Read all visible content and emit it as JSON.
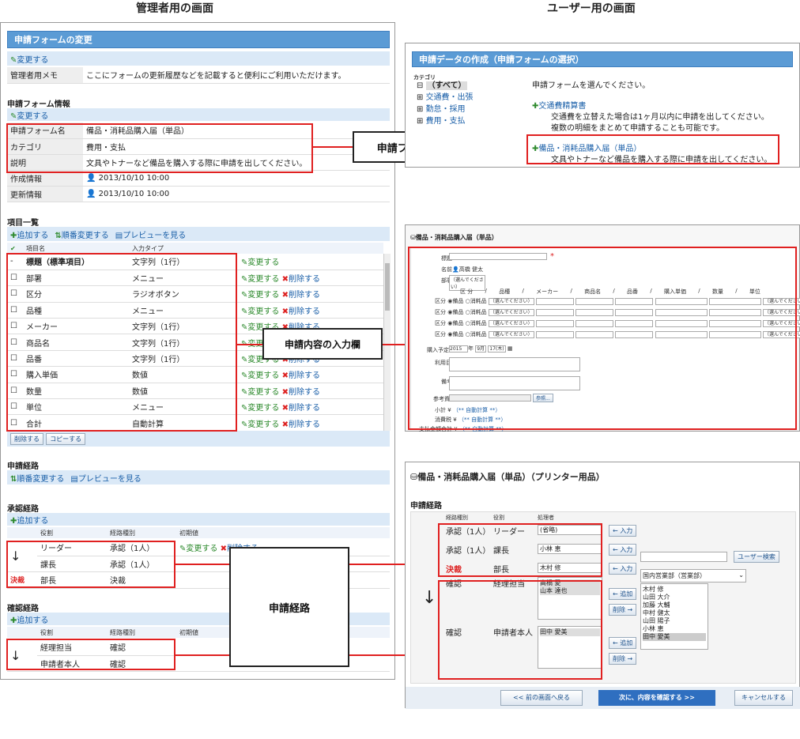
{
  "headings": {
    "admin": "管理者用の画面",
    "user": "ユーザー用の画面"
  },
  "admin": {
    "title": "申請フォームの変更",
    "change_link": "変更する",
    "memo_label": "管理者用メモ",
    "memo_value": "ここにフォームの更新履歴などを記載すると便利にご利用いただけます。",
    "info_section": "申請フォーム情報",
    "info": [
      {
        "k": "申請フォーム名",
        "v": "備品・消耗品購入届（単品）"
      },
      {
        "k": "カテゴリ",
        "v": "費用・支払"
      },
      {
        "k": "説明",
        "v": "文具やトナーなど備品を購入する際に申請を出してください。"
      },
      {
        "k": "作成情報",
        "v": "2013/10/10 10:00"
      },
      {
        "k": "更新情報",
        "v": "2013/10/10 10:00"
      }
    ],
    "items_section": "項目一覧",
    "items_links": [
      "追加する",
      "順番変更する",
      "プレビューを見る"
    ],
    "items_head": [
      "項目名",
      "入力タイプ"
    ],
    "items": [
      {
        "chk": "-",
        "name": "標題（標準項目）",
        "type": "文字列（1行）",
        "del": false
      },
      {
        "chk": "☐",
        "name": "部署",
        "type": "メニュー",
        "del": true
      },
      {
        "chk": "☐",
        "name": "区分",
        "type": "ラジオボタン",
        "del": true
      },
      {
        "chk": "☐",
        "name": "品種",
        "type": "メニュー",
        "del": true
      },
      {
        "chk": "☐",
        "name": "メーカー",
        "type": "文字列（1行）",
        "del": true
      },
      {
        "chk": "☐",
        "name": "商品名",
        "type": "文字列（1行）",
        "del": true
      },
      {
        "chk": "☐",
        "name": "品番",
        "type": "文字列（1行）",
        "del": true
      },
      {
        "chk": "☐",
        "name": "購入単価",
        "type": "数値",
        "del": true
      },
      {
        "chk": "☐",
        "name": "数量",
        "type": "数値",
        "del": true
      },
      {
        "chk": "☐",
        "name": "単位",
        "type": "メニュー",
        "del": true
      },
      {
        "chk": "☐",
        "name": "合計",
        "type": "自動計算",
        "del": true
      }
    ],
    "change_label": "変更する",
    "delete_label": "削除する",
    "bottom_btns": [
      "削除する",
      "コピーする"
    ],
    "route_section": "申請経路",
    "route_links": [
      "順番変更する",
      "プレビューを見る"
    ],
    "approval_section": "承認経路",
    "add_label": "追加する",
    "route_head": [
      "役割",
      "経路種別",
      "初期値"
    ],
    "approval": [
      {
        "role": "リーダー",
        "kind": "承認（1人）"
      },
      {
        "role": "課長",
        "kind": "承認（1人）"
      },
      {
        "role": "部長",
        "kind": "決裁",
        "mark": "決裁"
      }
    ],
    "confirm_section": "確認経路",
    "confirm": [
      {
        "role": "経理担当",
        "kind": "確認"
      },
      {
        "role": "申請者本人",
        "kind": "確認"
      }
    ]
  },
  "callouts": {
    "form_name": "申請フォーム名",
    "input": "申請内容の入力欄",
    "route": "申請経路"
  },
  "user1": {
    "title": "申請データの作成（申請フォームの選択）",
    "cat_label": "カテゴリ",
    "cats": [
      "（すべて）",
      "交通費・出張",
      "勤怠・採用",
      "費用・支払"
    ],
    "prompt": "申請フォームを選んでください。",
    "form1_name": "交通費精算書",
    "form1_desc1": "交通費を立替えた場合は1ヶ月以内に申請を出してください。",
    "form1_desc2": "複数の明細をまとめて申請することも可能です。",
    "form2_name": "備品・消耗品購入届（単品）",
    "form2_desc": "文具やトナーなど備品を購入する際に申請を出してください。"
  },
  "user2": {
    "title": "備品・消耗品購入届（単品）",
    "rows": {
      "subject": "標題",
      "name": "名前",
      "name_val": "高橋 健太",
      "dept": "部署",
      "select": "（選んでください）",
      "cols": [
        "区 分",
        "品種",
        "メーカー",
        "商品名",
        "品番",
        "購入単価",
        "数量",
        "単位"
      ],
      "kubun": "区分",
      "radio1": "備品",
      "radio2": "消耗品",
      "buydate": "購入予定日",
      "year": "2015",
      "y": "年",
      "month": "9月",
      "day": "17(木)",
      "usage": "利用目的",
      "note": "備考",
      "file": "参考資料",
      "ref_btn": "参照...",
      "subtotal": "小計",
      "tax": "消費税",
      "total": "支払金額合計",
      "yen": "¥",
      "auto": "（** 自動計算 **）"
    }
  },
  "user3": {
    "title": "備品・消耗品購入届（単品）（プリンター用品）",
    "route_label": "申請経路",
    "head": [
      "経路種別",
      "役割",
      "処理者"
    ],
    "rows": [
      {
        "kind": "承認（1人）",
        "role": "リーダー",
        "val": "(省略)"
      },
      {
        "kind": "承認（1人）",
        "role": "課長",
        "val": "小林 恵"
      },
      {
        "kind": "決裁",
        "role": "部長",
        "val": "木村 修"
      }
    ],
    "confirm_rows": [
      {
        "kind": "確認",
        "role": "経理担当",
        "vals": [
          "高橋 愛",
          "山本 達也"
        ]
      },
      {
        "kind": "確認",
        "role": "申請者本人",
        "vals": [
          "田中 愛美"
        ]
      }
    ],
    "in_btn": "← 入力",
    "add_btn": "← 追加",
    "del_btn": "削除 →",
    "search_btn": "ユーザー検索",
    "org": "国内営業部（営業部）",
    "users": [
      "木村 修",
      "山田 大介",
      "加藤 大輔",
      "中村 健太",
      "山田 陽子",
      "小林 恵",
      "田中 愛美"
    ],
    "back": "<< 前の画面へ戻る",
    "next": "次に、内容を確認する >>",
    "cancel": "キャンセルする"
  }
}
